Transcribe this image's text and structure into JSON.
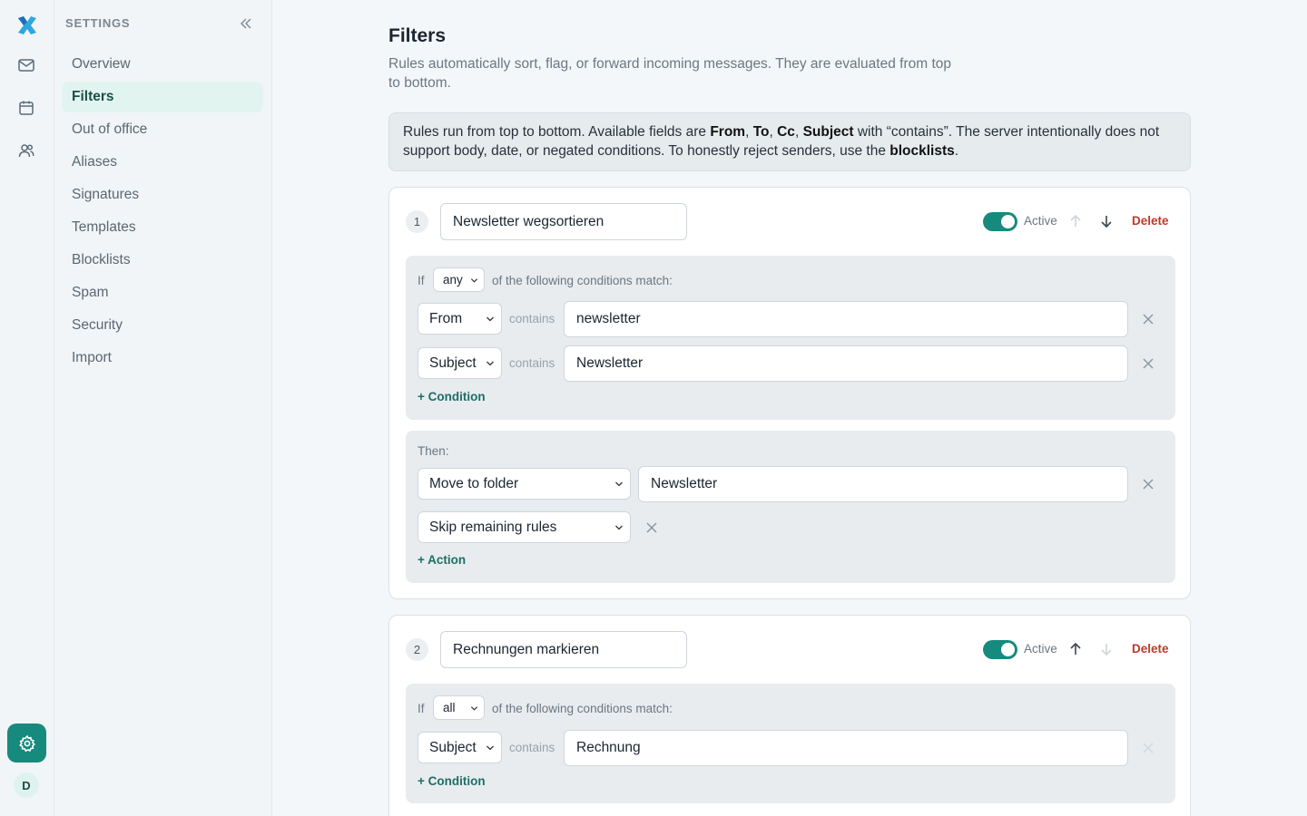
{
  "rail": {
    "logo": "x-logo-icon",
    "items": [
      "mail-icon",
      "calendar-icon",
      "contacts-icon"
    ],
    "settings": "gear-icon",
    "avatar": "D",
    "accent": "#178a7e"
  },
  "sidebar": {
    "title": "SETTINGS",
    "items": [
      {
        "label": "Overview",
        "active": false
      },
      {
        "label": "Filters",
        "active": true
      },
      {
        "label": "Out of office",
        "active": false
      },
      {
        "label": "Aliases",
        "active": false
      },
      {
        "label": "Signatures",
        "active": false
      },
      {
        "label": "Templates",
        "active": false
      },
      {
        "label": "Blocklists",
        "active": false
      },
      {
        "label": "Spam",
        "active": false
      },
      {
        "label": "Security",
        "active": false
      },
      {
        "label": "Import",
        "active": false
      }
    ]
  },
  "page": {
    "title": "Filters",
    "description": "Rules automatically sort, flag, or forward incoming messages. They are evaluated from top to bottom.",
    "info": {
      "t1": "Rules run from top to bottom. Available fields are ",
      "f1": "From",
      "c1": ", ",
      "f2": "To",
      "c2": ", ",
      "f3": "Cc",
      "c3": ", ",
      "f4": "Subject",
      "t2": " with “contains”. The server intentionally does not support body, date, or negated conditions. To honestly reject senders, use the ",
      "link": "blocklists",
      "t3": "."
    }
  },
  "labels": {
    "active": "Active",
    "delete": "Delete",
    "if": "If",
    "match_suffix": "of the following conditions match:",
    "contains": "contains",
    "then": "Then:",
    "add_condition": "+ Condition",
    "add_action": "+ Action"
  },
  "rules": [
    {
      "number": "1",
      "name": "Newsletter wegsortieren",
      "active": true,
      "match": "any",
      "conditions": [
        {
          "field": "From",
          "value": "newsletter"
        },
        {
          "field": "Subject",
          "value": "Newsletter"
        }
      ],
      "actions": [
        {
          "type": "Move to folder",
          "value": "Newsletter"
        },
        {
          "type": "Skip remaining rules"
        }
      ]
    },
    {
      "number": "2",
      "name": "Rechnungen markieren",
      "active": true,
      "match": "all",
      "conditions": [
        {
          "field": "Subject",
          "value": "Rechnung"
        }
      ]
    }
  ]
}
